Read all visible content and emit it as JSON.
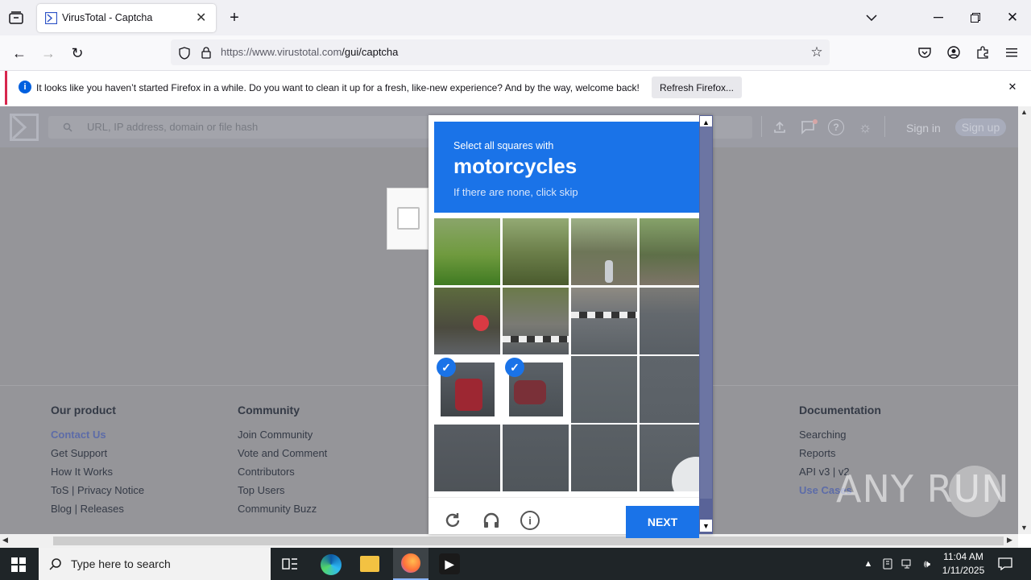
{
  "browser": {
    "tab_title": "VirusTotal - Captcha",
    "url_host": "https://www.virustotal.com",
    "url_path": "/gui/captcha",
    "notification": "It looks like you haven’t started Firefox in a while. Do you want to clean it up for a fresh, like-new experience? And by the way, welcome back!",
    "refresh_button": "Refresh Firefox..."
  },
  "vt": {
    "search_placeholder": "URL, IP address, domain or file hash",
    "sign_in": "Sign in",
    "sign_up": "Sign up"
  },
  "footer": {
    "col1": {
      "heading": "Our product",
      "links": [
        "Contact Us",
        "Get Support",
        "How It Works",
        "ToS | Privacy Notice",
        "Blog | Releases"
      ]
    },
    "col2": {
      "heading": "Community",
      "links": [
        "Join Community",
        "Vote and Comment",
        "Contributors",
        "Top Users",
        "Community Buzz"
      ]
    },
    "col3": {
      "heading": "Documentation",
      "links": [
        "Searching",
        "Reports",
        "API v3 | v2",
        "Use Cases"
      ]
    }
  },
  "captcha": {
    "select_text": "Select all squares with",
    "object": "motorcycles",
    "skip_text": "If there are none, click skip",
    "next_button": "NEXT",
    "selected_tiles": [
      8,
      9
    ]
  },
  "taskbar": {
    "search_placeholder": "Type here to search",
    "time": "11:04 AM",
    "date": "1/11/2025"
  },
  "watermark": "ANY RUN",
  "colors": {
    "captcha_blue": "#1a73e8",
    "page_overlay": "#959599",
    "scrollbar_navy": "#596398"
  }
}
